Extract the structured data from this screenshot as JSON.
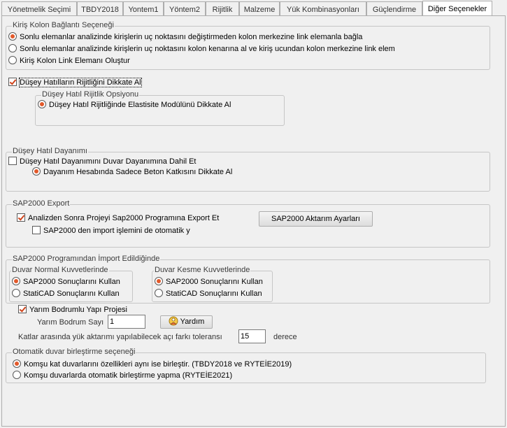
{
  "tabs": [
    {
      "label": "Yönetmelik Seçimi"
    },
    {
      "label": "TBDY2018"
    },
    {
      "label": "Yontem1"
    },
    {
      "label": "Yöntem2"
    },
    {
      "label": "Rijitlik"
    },
    {
      "label": "Malzeme"
    },
    {
      "label": "Yük Kombinasyonları"
    },
    {
      "label": "Güçlendirme"
    },
    {
      "label": "Diğer Seçenekler"
    }
  ],
  "kiris_kolon": {
    "legend": "Kiriş Kolon Bağlantı Seçeneği",
    "options": [
      {
        "label": "Sonlu elemanlar analizinde kirişlerin uç noktasını değiştirmeden kolon merkezine link elemanla bağla",
        "selected": true
      },
      {
        "label": "Sonlu elemanlar analizinde kirişlerin uç noktasını kolon kenarına al ve kiriş ucundan kolon merkezine link elem",
        "selected": false
      },
      {
        "label": "Kiriş Kolon Link Elemanı Oluştur",
        "selected": false
      }
    ]
  },
  "dusey_rijitlik": {
    "checkbox_label": "Düşey Hatılların Rijitliğini Dikkate Al",
    "checked": true,
    "legend": "Düşey Hatıl Rijitlik Opsiyonu",
    "option_label": "Düşey Hatıl Rijitliğinde Elastisite Modülünü Dikkate Al"
  },
  "dusey_dayanim": {
    "legend": "Düşey Hatıl Dayanımı",
    "checkbox_label": "Düşey Hatıl Dayanımını Duvar Dayanımına Dahil Et",
    "checked": false,
    "option_label": "Dayanım Hesabında Sadece Beton Katkısını Dikkate Al"
  },
  "sap_export": {
    "legend": "SAP2000 Export",
    "export_label": "Analizden Sonra Projeyi Sap2000 Programına Export Et",
    "export_checked": true,
    "import_label": "SAP2000 den import işlemini de otomatik y",
    "import_checked": false,
    "settings_button": "SAP2000 Aktarım Ayarları"
  },
  "sap_import": {
    "legend": "SAP2000 Programından İmport Edildiğinde",
    "normal": {
      "legend": "Duvar Normal Kuvvetlerinde",
      "options": [
        {
          "label": "SAP2000 Sonuçlarını Kullan",
          "selected": true
        },
        {
          "label": "StatiCAD Sonuçlarını Kullan",
          "selected": false
        }
      ]
    },
    "kesme": {
      "legend": "Duvar Kesme Kuvvetlerinde",
      "options": [
        {
          "label": "SAP2000 Sonuçlarını Kullan",
          "selected": true
        },
        {
          "label": "StatiCAD Sonuçlarını Kullan",
          "selected": false
        }
      ]
    }
  },
  "bodrum": {
    "checkbox_label": "Yarım Bodrumlu Yapı Projesi",
    "checked": true,
    "count_label": "Yarım Bodrum Sayı",
    "count_value": "1",
    "help_button": "Yardım"
  },
  "aci": {
    "label": "Katlar arasında yük aktarımı yapılabilecek açı farkı toleransı",
    "value": "15",
    "unit": "derece"
  },
  "otomatik": {
    "legend": "Otomatik duvar birleştirme seçeneği",
    "options": [
      {
        "label": "Komşu kat duvarlarını özellikleri aynı ise birleştir. (TBDY2018 ve RYTEİE2019)",
        "selected": true
      },
      {
        "label": "Komşu duvarlarda otomatik birleştirme yapma  (RYTEİE2021)",
        "selected": false
      }
    ]
  }
}
